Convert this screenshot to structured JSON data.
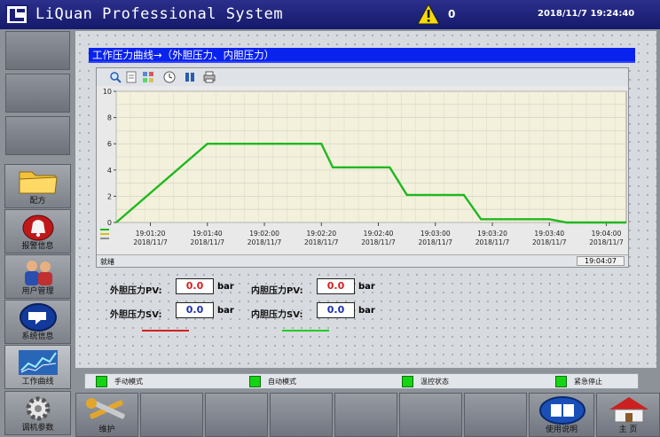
{
  "titlebar": {
    "app_title": "LiQuan Professional System",
    "alarm_count": "0",
    "datetime": "2018/11/7 19:24:40"
  },
  "sidebar": {
    "items": [
      {
        "label": "配方",
        "icon": "folder-icon"
      },
      {
        "label": "报警信息",
        "icon": "alarm-bell-icon"
      },
      {
        "label": "用户管理",
        "icon": "users-icon"
      },
      {
        "label": "系统信息",
        "icon": "system-info-icon"
      },
      {
        "label": "工作曲线",
        "icon": "trend-chart-icon"
      },
      {
        "label": "调机参数",
        "icon": "gear-icon"
      }
    ]
  },
  "panel": {
    "header": "工作压力曲线→（外胆压力、内胆压力）"
  },
  "trend": {
    "status_text": "就绪",
    "status_time": "19:04:07"
  },
  "chart_data": {
    "type": "line",
    "x": [
      "19:01:08",
      "19:01:40",
      "19:02:20",
      "19:02:24",
      "19:02:44",
      "19:02:50",
      "19:03:10",
      "19:03:16",
      "19:03:40",
      "19:03:46",
      "19:04:07"
    ],
    "x_ticks": [
      {
        "time": "19:01:20",
        "date": "2018/11/7"
      },
      {
        "time": "19:01:40",
        "date": "2018/11/7"
      },
      {
        "time": "19:02:00",
        "date": "2018/11/7"
      },
      {
        "time": "19:02:20",
        "date": "2018/11/7"
      },
      {
        "time": "19:02:40",
        "date": "2018/11/7"
      },
      {
        "time": "19:03:00",
        "date": "2018/11/7"
      },
      {
        "time": "19:03:20",
        "date": "2018/11/7"
      },
      {
        "time": "19:03:40",
        "date": "2018/11/7"
      },
      {
        "time": "19:04:00",
        "date": "2018/11/7"
      }
    ],
    "series": [
      {
        "color": "#1fb81f",
        "values": [
          0,
          6,
          6,
          4.2,
          4.2,
          2.1,
          2.1,
          0.25,
          0.25,
          0,
          0
        ]
      }
    ],
    "y_ticks": [
      0,
      2,
      4,
      6,
      8,
      10
    ],
    "ylim": [
      0,
      10
    ],
    "grid": true
  },
  "readouts": {
    "outer_pv_label": "外胆压力PV:",
    "outer_pv_value": "0.0",
    "outer_sv_label": "外胆压力SV:",
    "outer_sv_value": "0.0",
    "inner_pv_label": "内胆压力PV:",
    "inner_pv_value": "0.0",
    "inner_sv_label": "内胆压力SV:",
    "inner_sv_value": "0.0",
    "unit": "bar",
    "outer_color": "#d42020",
    "inner_color": "#22cc22",
    "pv_value_color": "#d42020",
    "sv_value_color": "#1a2fb0"
  },
  "status_strip": {
    "items": [
      "手动模式",
      "自动模式",
      "温控状态",
      "紧急停止"
    ]
  },
  "bottombar": {
    "maintain_label": "维护",
    "manual_label": "使用说明",
    "home_label": "主 页"
  }
}
